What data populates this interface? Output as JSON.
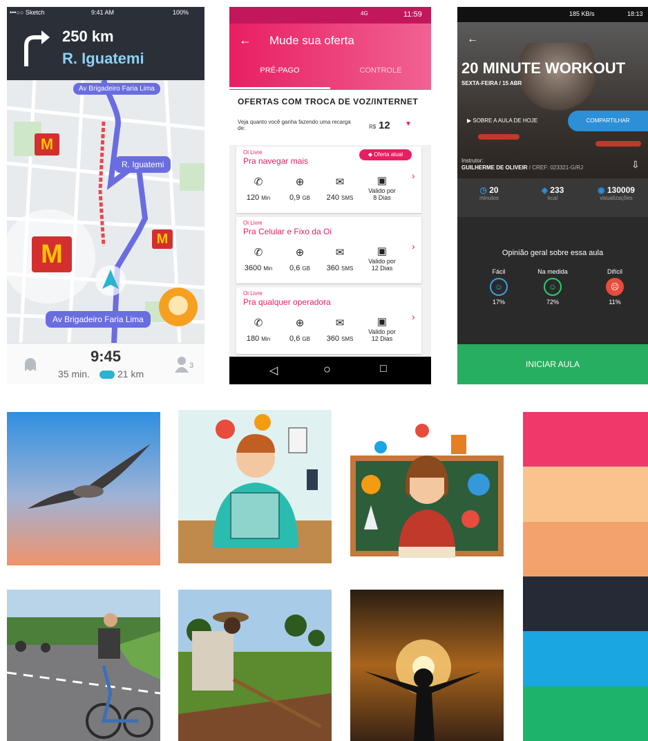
{
  "waze": {
    "status_left": "•••○○ Sketch",
    "status_time": "9:41 AM",
    "status_battery": "100%",
    "distance": "250 km",
    "street": "R. Iguatemi",
    "road_top": "Av Brigadeiro Faria Lima",
    "road_mid": "R. Iguatemi",
    "road_bottom": "Av Brigadeiro Faria Lima",
    "eta_time": "9:45",
    "eta_min": "35 min.",
    "eta_km": "21 km",
    "people_count": "3",
    "brand_letter": "M",
    "colors": {
      "accent": "#6a6de0",
      "traffic": "#e8474f",
      "dark": "#2b3038"
    }
  },
  "oi": {
    "status_time": "11:59",
    "status_net": "4G",
    "title": "Mude sua oferta",
    "tabs": [
      "PRÉ-PAGO",
      "CONTROLE"
    ],
    "section_title": "OFERTAS COM TROCA DE VOZ/INTERNET",
    "recharge_label": "Veja quanto você ganha fazendo uma recarga de:",
    "currency": "R$",
    "recharge_value": "12",
    "current_offer_label": "Oferta atual",
    "offers": [
      {
        "tag": "Oi Livre",
        "name": "Pra navegar mais",
        "min": "120",
        "min_unit": "Min",
        "data": "0,9",
        "data_unit": "GB",
        "sms": "240",
        "sms_unit": "SMS",
        "valid_line1": "Valido por",
        "valid_line2": "8 Dias"
      },
      {
        "tag": "Oi Livre",
        "name": "Pra Celular e Fixo da Oi",
        "min": "3600",
        "min_unit": "Min",
        "data": "0,6",
        "data_unit": "GB",
        "sms": "360",
        "sms_unit": "SMS",
        "valid_line1": "Valido por",
        "valid_line2": "12 Dias"
      },
      {
        "tag": "Oi Livre",
        "name": "Pra qualquer operadora",
        "min": "180",
        "min_unit": "Min",
        "data": "0,6",
        "data_unit": "GB",
        "sms": "360",
        "sms_unit": "SMS",
        "valid_line1": "Valido por",
        "valid_line2": "12 Dias"
      }
    ],
    "colors": {
      "accent": "#e91e63"
    }
  },
  "workout": {
    "status_speed": "185 KB/s",
    "status_time": "18:13",
    "title": "20 MINUTE WORKOUT",
    "date": "SEXTA-FEIRA / 15 ABR",
    "about_label": "SOBRE A AULA DE HOJE",
    "share_label": "COMPARTILHAR",
    "instructor_label": "Instrutor:",
    "instructor_name": "GUILHERME DE OLIVEIR",
    "instructor_cref": "/ CREF: 023321-G/RJ",
    "stats": [
      {
        "value": "20",
        "label": "minutos"
      },
      {
        "value": "233",
        "label": "kcal"
      },
      {
        "value": "130009",
        "label": "visualizações"
      }
    ],
    "opinion_title": "Opinião geral sobre essa aula",
    "ratings": [
      {
        "label": "Fácil",
        "percent": "17%",
        "color": "#3aa0e0"
      },
      {
        "label": "Na medida",
        "percent": "72%",
        "color": "#2ecc71"
      },
      {
        "label": "Difícil",
        "percent": "11%",
        "color": "#e74c3c"
      }
    ],
    "cta": "INICIAR AULA"
  },
  "images": [
    {
      "subject": "seagull-in-sky"
    },
    {
      "subject": "multitasking-man-illustration"
    },
    {
      "subject": "teacher-illustration"
    },
    {
      "subject": "cyclists-on-road"
    },
    {
      "subject": "farmer-with-hoe"
    },
    {
      "subject": "person-arms-open-sunset"
    }
  ],
  "palette": [
    "#f0386b",
    "#f9c38d",
    "#f4a26c",
    "#252a36",
    "#1aa6e0",
    "#1db36a"
  ]
}
